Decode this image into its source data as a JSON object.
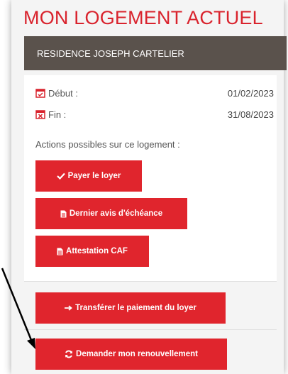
{
  "page": {
    "title": "MON LOGEMENT ACTUEL"
  },
  "residence": {
    "name": "RESIDENCE JOSEPH CARTELIER"
  },
  "dates": {
    "start_label": "Début :",
    "start_value": "01/02/2023",
    "end_label": "Fin :",
    "end_value": "31/08/2023"
  },
  "actions": {
    "label": "Actions possibles sur ce logement :",
    "pay_rent": "Payer le loyer",
    "last_notice": "Dernier avis d'échéance",
    "caf_certificate": "Attestation CAF",
    "transfer_payment": "Transférer le paiement du loyer",
    "renewal": "Demander mon renouvellement"
  },
  "colors": {
    "accent": "#e0252d",
    "title": "#d9232d",
    "header_bar": "#5a524c"
  },
  "icons": {
    "start": "calendar-check-icon",
    "end": "calendar-x-icon",
    "pay": "check-icon",
    "doc": "document-icon",
    "transfer": "arrow-right-icon",
    "renew": "refresh-icon"
  }
}
